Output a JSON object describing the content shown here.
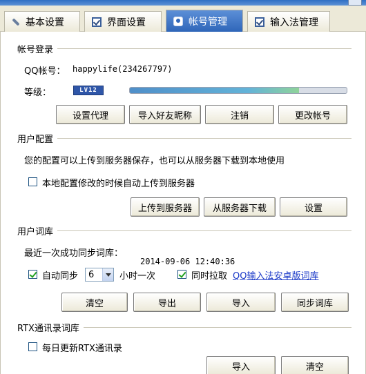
{
  "tabs": [
    {
      "label": "基本设置",
      "icon": "wrench-icon",
      "active": false
    },
    {
      "label": "界面设置",
      "icon": "check-box-icon",
      "active": false
    },
    {
      "label": "帐号管理",
      "icon": "user-icon",
      "active": true
    },
    {
      "label": "输入法管理",
      "icon": "check-box-icon",
      "active": false
    }
  ],
  "account": {
    "section_title": "帐号登录",
    "qq_label": "QQ帐号：",
    "qq_value": "happylife(234267797)",
    "level_label": "等级：",
    "level_badge": "LV12",
    "level_progress": 0.78,
    "buttons": {
      "proxy": "设置代理",
      "import_nick": "导入好友昵称",
      "logout": "注销",
      "change_account": "更改帐号"
    }
  },
  "user_config": {
    "section_title": "用户配置",
    "description": "您的配置可以上传到服务器保存，也可以从服务器下载到本地使用",
    "auto_upload_label": "本地配置修改的时候自动上传到服务器",
    "auto_upload_checked": false,
    "buttons": {
      "upload": "上传到服务器",
      "download": "从服务器下载",
      "settings": "设置"
    }
  },
  "user_dict": {
    "section_title": "用户词库",
    "last_sync_label": "最近一次成功同步词库：",
    "last_sync_time": "2014-09-06 12:40:36",
    "auto_sync_label": "自动同步",
    "auto_sync_checked": true,
    "interval_value": "6",
    "interval_unit": "小时一次",
    "pull_label": "同时拉取",
    "pull_checked": true,
    "pull_link": "QQ输入法安卓版词库",
    "buttons": {
      "clear": "清空",
      "export": "导出",
      "import": "导入",
      "sync": "同步词库"
    }
  },
  "rtx": {
    "section_title": "RTX通讯录词库",
    "daily_update_label": "每日更新RTX通讯录",
    "daily_update_checked": false,
    "buttons": {
      "import": "导入",
      "clear": "清空"
    }
  }
}
